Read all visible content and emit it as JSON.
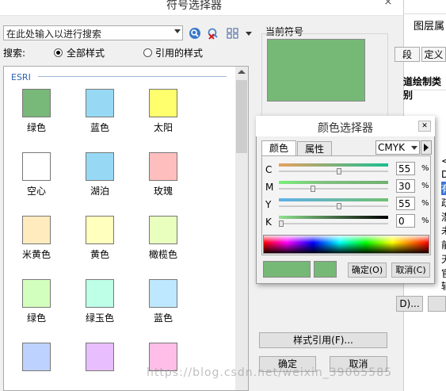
{
  "dialog": {
    "title": "符号选择器",
    "search_value": "在此处输入以进行搜索",
    "search_label": "搜索:",
    "radio_all": "全部样式",
    "radio_ref": "引用的样式",
    "group_label": "ESRI",
    "current_symbol_label": "当前符号",
    "current_color": "#76b976",
    "style_ref_button": "样式引用(F)...",
    "ok_button": "确定",
    "cancel_button": "取消"
  },
  "swatches": [
    {
      "label": "绿色",
      "color": "#78b878"
    },
    {
      "label": "蓝色",
      "color": "#97d9f4"
    },
    {
      "label": "太阳",
      "color": "#ffff6e"
    },
    {
      "label": "空心",
      "color": "#ffffff"
    },
    {
      "label": "湖泊",
      "color": "#97d9f4"
    },
    {
      "label": "玫瑰",
      "color": "#ffbebe"
    },
    {
      "label": "米黄色",
      "color": "#ffebbe"
    },
    {
      "label": "黄色",
      "color": "#ffffbe"
    },
    {
      "label": "橄榄色",
      "color": "#e9ffbe"
    },
    {
      "label": "绿色",
      "color": "#d3ffbe"
    },
    {
      "label": "绿玉色",
      "color": "#beffe8"
    },
    {
      "label": "蓝色",
      "color": "#bee8ff"
    },
    {
      "label": "",
      "color": "#bed2ff"
    },
    {
      "label": "",
      "color": "#e8beff"
    },
    {
      "label": "",
      "color": "#ffbee8"
    }
  ],
  "right_panel": {
    "title": "图层属",
    "tab1": "段",
    "tab2": "定义",
    "text1": "道绘制类别",
    "letters": [
      "<",
      "D",
      "有",
      "疏",
      "潜",
      "未",
      "前",
      "天",
      "官",
      "辅"
    ],
    "btn": "D)..."
  },
  "color_picker": {
    "title": "颜色选择器",
    "tab_color": "颜色",
    "tab_props": "属性",
    "model": "CMYK",
    "channels": [
      {
        "name": "C",
        "value": "55",
        "fraction": 0.55,
        "gradient": "linear-gradient(to right,#e8a060,#18c090)"
      },
      {
        "name": "M",
        "value": "30",
        "fraction": 0.3,
        "gradient": "linear-gradient(to right,#78f078,#80c080 40%,#70b070)"
      },
      {
        "name": "Y",
        "value": "55",
        "fraction": 0.55,
        "gradient": "linear-gradient(to right,#60b0e8,#70c070)"
      },
      {
        "name": "K",
        "value": "0",
        "fraction": 0.0,
        "gradient": "linear-gradient(to right,#90e090,#000000)"
      }
    ],
    "percent": "%",
    "old_color": "#76b976",
    "new_color": "#76b976",
    "ok": "确定(O)",
    "cancel": "取消(C)"
  },
  "watermark": "https://blog.csdn.net/weixin_39065585"
}
